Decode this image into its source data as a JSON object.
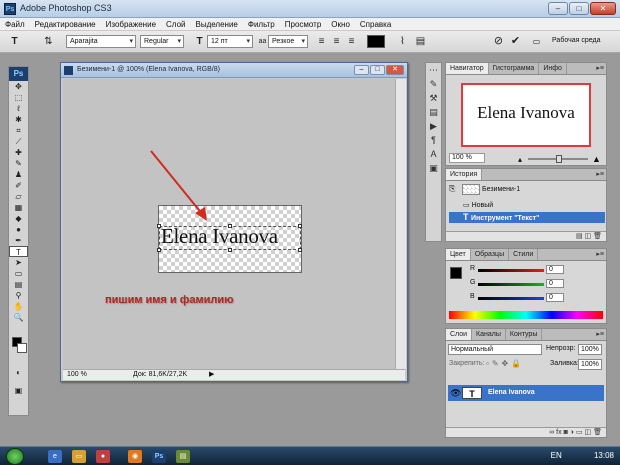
{
  "app": {
    "title": "Adobe Photoshop CS3",
    "logo": "Ps"
  },
  "menu": [
    "Файл",
    "Редактирование",
    "Изображение",
    "Слой",
    "Выделение",
    "Фильтр",
    "Просмотр",
    "Окно",
    "Справка"
  ],
  "options": {
    "tool_icon": "T",
    "font_family": "Aparajita",
    "font_style": "Regular",
    "font_size": "12 пт",
    "antialias": "Резкое",
    "workspace": "Рабочая среда"
  },
  "document": {
    "title": "Безимени-1 @ 100% (Elena Ivanova, RGB/8)",
    "text": "Elena Ivanova",
    "zoom": "100 %",
    "doc_size": "Док: 81,6K/27,2K"
  },
  "caption": "пишим имя и фамилию",
  "navigator": {
    "tabs": [
      "Навигатор",
      "Гистограмма",
      "Инфо"
    ],
    "preview_text": "Elena Ivanova",
    "zoom": "100 %"
  },
  "history": {
    "tabs": [
      "История"
    ],
    "snapshot": "Безимени-1",
    "items": [
      "Новый",
      "Инструмент \"Текст\""
    ]
  },
  "color": {
    "tabs": [
      "Цвет",
      "Образцы",
      "Стили"
    ],
    "channels": [
      {
        "label": "R",
        "value": "0",
        "color": "#d43030"
      },
      {
        "label": "G",
        "value": "0",
        "color": "#2e9c2e"
      },
      {
        "label": "B",
        "value": "0",
        "color": "#2f52c8"
      }
    ]
  },
  "layers": {
    "tabs": [
      "Слои",
      "Каналы",
      "Контуры"
    ],
    "blend_mode": "Нормальный",
    "opacity_label": "Непрозр:",
    "opacity": "100%",
    "lock_label": "Закрепить:",
    "fill_label": "Заливка:",
    "fill": "100%",
    "layer_name": "Elena Ivanova",
    "layer_thumb": "T"
  },
  "taskbar": {
    "lang": "EN",
    "time": "13:08"
  }
}
